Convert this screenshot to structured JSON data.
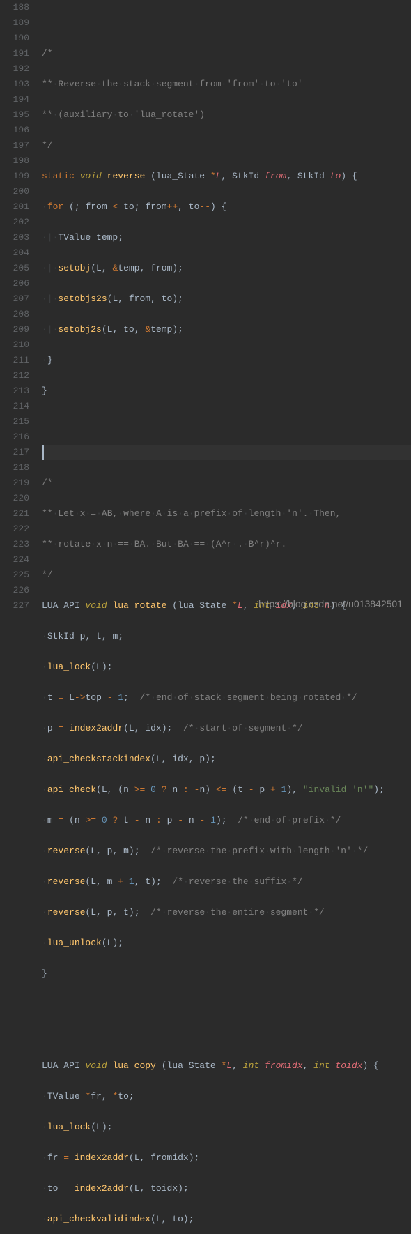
{
  "gutter": {
    "start": 188,
    "end": 227
  },
  "watermark": "https://blog.csdn.net/u013842501",
  "code": {
    "l188": "",
    "l189": "/*",
    "l190": "** Reverse the stack segment from 'from' to 'to'",
    "l191": "** (auxiliary to 'lua_rotate')",
    "l192": "*/",
    "l193_kw1": "static",
    "l193_type": "void",
    "l193_fn": "reverse",
    "l193_p1t": "lua_State",
    "l193_p1": "L",
    "l193_p2t": "StkId",
    "l193_p2": "from",
    "l193_p3t": "StkId",
    "l193_p3": "to",
    "l194_kw": "for",
    "l194_ident": "from",
    "l194_op1": "<",
    "l194_to": "to",
    "l194_from2": "from",
    "l194_pp": "++",
    "l194_to2": "to",
    "l194_mm": "--",
    "l195_t": "TValue",
    "l195_v": "temp",
    "l196_fn": "setobj",
    "l196_a1": "L",
    "l196_amp": "&",
    "l196_a2": "temp",
    "l196_a3": "from",
    "l197_fn": "setobjs2s",
    "l197_a1": "L",
    "l197_a2": "from",
    "l197_a3": "to",
    "l198_fn": "setobj2s",
    "l198_a1": "L",
    "l198_a2": "to",
    "l198_amp": "&",
    "l198_a3": "temp",
    "l199": "}",
    "l200": "}",
    "l203": "/*",
    "l204": "** Let x = AB, where A is a prefix of length 'n'. Then,",
    "l205": "** rotate x n == BA. But BA == (A^r . B^r)^r.",
    "l206": "*/",
    "l207_api": "LUA_API",
    "l207_type": "void",
    "l207_fn": "lua_rotate",
    "l207_p1t": "lua_State",
    "l207_p1": "L",
    "l207_p2t": "int",
    "l207_p2": "idx",
    "l207_p3t": "int",
    "l207_p3": "n",
    "l208_t": "StkId",
    "l208_v1": "p",
    "l208_v2": "t",
    "l208_v3": "m",
    "l209_fn": "lua_lock",
    "l209_a": "L",
    "l210_lhs": "t",
    "l210_a": "L",
    "l210_b": "top",
    "l210_n": "1",
    "l210_c": "/* end of stack segment being rotated */",
    "l211_lhs": "p",
    "l211_fn": "index2addr",
    "l211_a1": "L",
    "l211_a2": "idx",
    "l211_c": "/* start of segment */",
    "l212_fn": "api_checkstackindex",
    "l212_a1": "L",
    "l212_a2": "idx",
    "l212_a3": "p",
    "l213_fn": "api_check",
    "l213_a1": "L",
    "l213_n": "n",
    "l213_z": "0",
    "l213_nn": "n",
    "l213_nm": "n",
    "l213_t": "t",
    "l213_p": "p",
    "l213_one": "1",
    "l213_str": "\"invalid 'n'\"",
    "l214_lhs": "m",
    "l214_n": "n",
    "l214_z": "0",
    "l214_t": "t",
    "l214_nn": "n",
    "l214_p": "p",
    "l214_nm": "n",
    "l214_one": "1",
    "l214_c": "/* end of prefix */",
    "l215_fn": "reverse",
    "l215_a1": "L",
    "l215_a2": "p",
    "l215_a3": "m",
    "l215_c": "/* reverse the prefix with length 'n' */",
    "l216_fn": "reverse",
    "l216_a1": "L",
    "l216_a2": "m",
    "l216_one": "1",
    "l216_a3": "t",
    "l216_c": "/* reverse the suffix */",
    "l217_fn": "reverse",
    "l217_a1": "L",
    "l217_a2": "p",
    "l217_a3": "t",
    "l217_c": "/* reverse the entire segment */",
    "l218_fn": "lua_unlock",
    "l218_a": "L",
    "l219": "}",
    "l222_api": "LUA_API",
    "l222_type": "void",
    "l222_fn": "lua_copy",
    "l222_p1t": "lua_State",
    "l222_p1": "L",
    "l222_p2t": "int",
    "l222_p2": "fromidx",
    "l222_p3t": "int",
    "l222_p3": "toidx",
    "l223_t": "TValue",
    "l223_v1": "fr",
    "l223_v2": "to",
    "l224_fn": "lua_lock",
    "l224_a": "L",
    "l225_lhs": "fr",
    "l225_fn": "index2addr",
    "l225_a1": "L",
    "l225_a2": "fromidx",
    "l226_lhs": "to",
    "l226_fn": "index2addr",
    "l226_a1": "L",
    "l226_a2": "toidx",
    "l227_fn": "api_checkvalidindex",
    "l227_a1": "L",
    "l227_a2": "to"
  }
}
